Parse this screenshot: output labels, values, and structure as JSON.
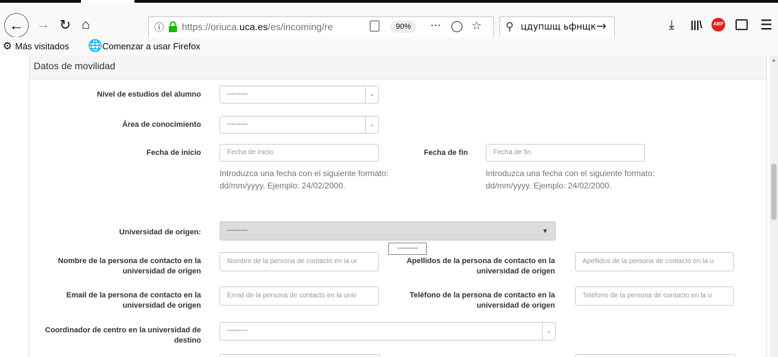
{
  "browser": {
    "url": "https://oriuca.uca.es/es/incoming/re",
    "url_prefix": "https://oriuca.",
    "url_domain": "uca.es",
    "url_path": "/es/incoming/re",
    "zoom": "90%",
    "search_text": "цдупшщ ьфнщк",
    "bookmarks": [
      "Más visitados",
      "Comenzar a usar Firefox"
    ],
    "icons": {
      "abp": "ABP"
    }
  },
  "section": {
    "title": "Datos de movilidad"
  },
  "form": {
    "nivel_label": "Nivel de estudios del alumno",
    "nivel_value": "---------",
    "area_label": "Área de conocimiento",
    "area_value": "---------",
    "fecha_inicio_label": "Fecha de inicio",
    "fecha_inicio_placeholder": "Fecha de inicio",
    "fecha_fin_label": "Fecha de fin",
    "fecha_fin_placeholder": "Fecha de fin",
    "date_help": "Introduzca una fecha con el siguiente formato: dd/mm/yyyy. Ejemplo: 24/02/2000.",
    "universidad_label": "Universidad de origen:",
    "universidad_value": "---------",
    "dropdown_tip": "---------",
    "nombre_label": "Nombre de la persona de contacto en la universidad de origen",
    "nombre_placeholder": "Nombre de la persona de contacto en la ur",
    "apellidos_label": "Apellidos de la persona de contacto en la universidad de origen",
    "apellidos_placeholder": "Apellidos de la persona de contacto en la u",
    "email_label": "Email de la persona de contacto en la universidad de origen",
    "email_placeholder": "Email de la persona de contacto en la univ",
    "telefono_label": "Teléfono de la persona de contacto en la universidad de origen",
    "telefono_placeholder": "Teléfono de la persona de contacto en la u",
    "coordinador_label": "Coordinador de centro en la universidad de destino",
    "coordinador_value": "---------"
  }
}
